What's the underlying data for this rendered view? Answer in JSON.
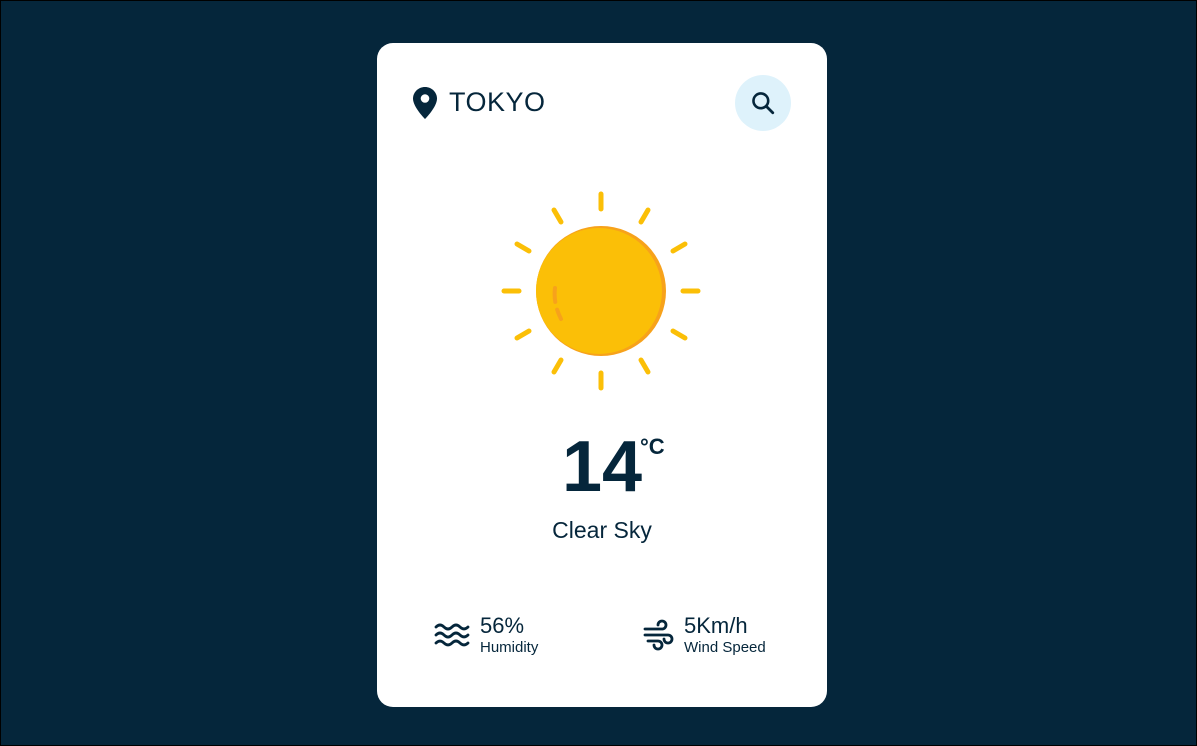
{
  "location": {
    "icon": "map-pin-icon",
    "city": "TOKYO"
  },
  "search": {
    "icon": "search-icon"
  },
  "weather": {
    "icon": "sun-icon",
    "temperature": "14",
    "unit": "°C",
    "description": "Clear Sky"
  },
  "stats": {
    "humidity": {
      "icon": "humidity-waves-icon",
      "value": "56%",
      "label": "Humidity"
    },
    "wind": {
      "icon": "wind-icon",
      "value": "5Km/h",
      "label": "Wind Speed"
    }
  },
  "colors": {
    "background": "#05263b",
    "card": "#ffffff",
    "text": "#05263b",
    "search_button_bg": "#def2fb",
    "sun_main": "#fbbf07",
    "sun_shadow": "#f7a21b"
  }
}
